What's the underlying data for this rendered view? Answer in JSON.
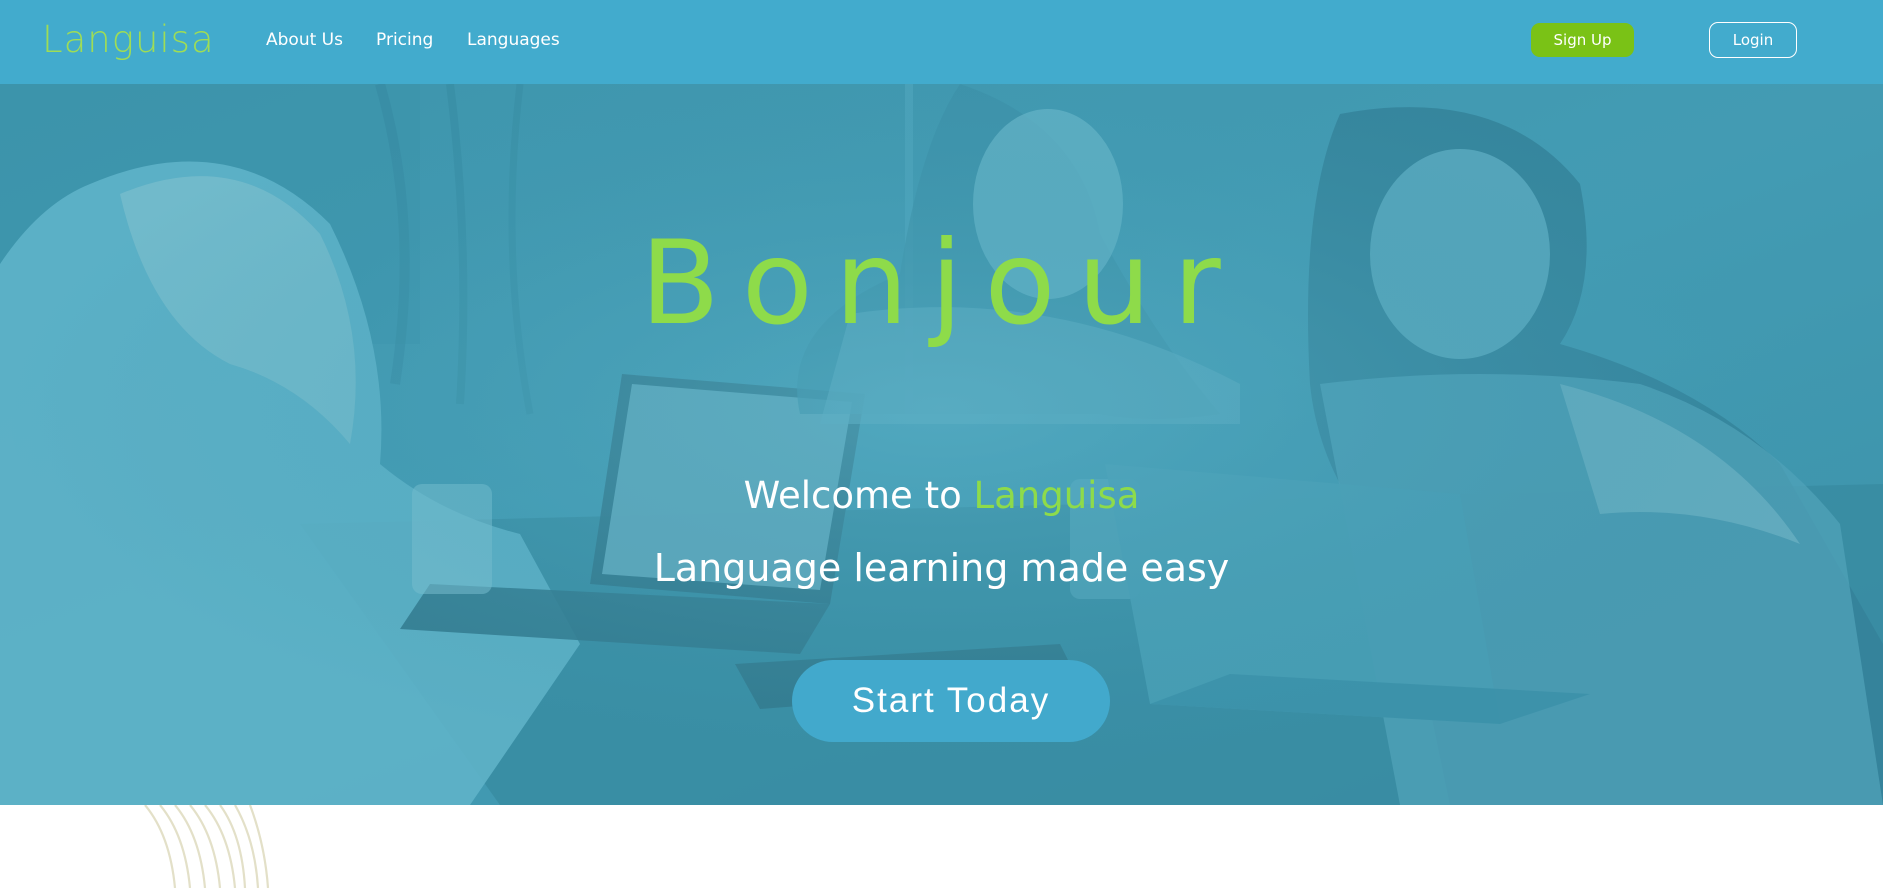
{
  "nav": {
    "logo": "Languisa",
    "links": [
      {
        "label": "About Us"
      },
      {
        "label": "Pricing"
      },
      {
        "label": "Languages"
      }
    ],
    "signup_label": "Sign Up",
    "login_label": "Login"
  },
  "hero": {
    "title": "Bonjour",
    "welcome_prefix": "Welcome to ",
    "welcome_brand": "Languisa",
    "tagline": "Language learning made easy",
    "cta_label": "Start Today"
  },
  "colors": {
    "nav_bg": "#42abcd",
    "brand_green": "#8edb4a",
    "signup_green": "#7ac216",
    "cta_blue": "#42a9cc",
    "hero_overlay": "#3e98b0"
  }
}
